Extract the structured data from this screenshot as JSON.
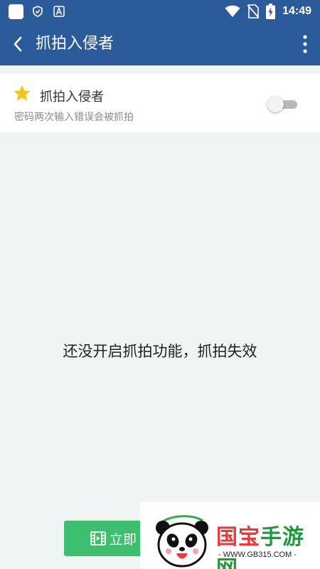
{
  "status_bar": {
    "time": "14:49",
    "icons": [
      "app-square-icon",
      "shield-icon",
      "font-a-icon",
      "wifi-icon",
      "no-sim-icon",
      "battery-charging-icon"
    ]
  },
  "toolbar": {
    "title": "抓拍入侵者",
    "back_icon": "back-arrow-icon",
    "more_icon": "more-vert-icon"
  },
  "setting": {
    "icon": "star-icon",
    "title": "抓拍入侵者",
    "description": "密码两次输入错误会被抓拍",
    "enabled": false
  },
  "empty_message": "还没开启抓拍功能，抓拍失效",
  "start_button": {
    "icon": "film-icon",
    "label": "立即"
  },
  "watermark": {
    "brand_part1": "国宝",
    "brand_part2": "手游网",
    "site": "- WWW.GB315.COM -"
  },
  "colors": {
    "primary": "#2c5b9c",
    "background": "#eff4f4",
    "accent": "#3ebf6f",
    "star": "#f5c21c"
  }
}
